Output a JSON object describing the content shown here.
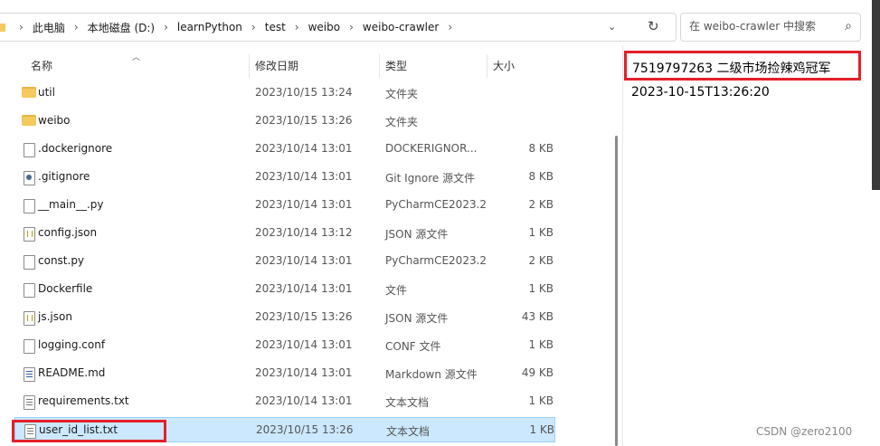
{
  "address_bar": {
    "path": [
      "此电脑",
      "本地磁盘 (D:)",
      "learnPython",
      "test",
      "weibo",
      "weibo-crawler"
    ]
  },
  "search": {
    "placeholder": "在 weibo-crawler 中搜索"
  },
  "columns": {
    "name": "名称",
    "date": "修改日期",
    "type": "类型",
    "size": "大小"
  },
  "files": [
    {
      "name": "util",
      "date": "2023/10/15 13:24",
      "type": "文件夹",
      "size": "",
      "icon": "folder-icon"
    },
    {
      "name": "weibo",
      "date": "2023/10/15 13:26",
      "type": "文件夹",
      "size": "",
      "icon": "folder-icon"
    },
    {
      "name": ".dockerignore",
      "date": "2023/10/14 13:01",
      "type": "DOCKERIGNOR...",
      "size": "8 KB",
      "icon": "file-icon"
    },
    {
      "name": ".gitignore",
      "date": "2023/10/14 13:01",
      "type": "Git Ignore 源文件",
      "size": "8 KB",
      "icon": "gear-file-icon"
    },
    {
      "name": "__main__.py",
      "date": "2023/10/14 13:01",
      "type": "PyCharmCE2023.2",
      "size": "2 KB",
      "icon": "file-icon"
    },
    {
      "name": "config.json",
      "date": "2023/10/14 13:12",
      "type": "JSON 源文件",
      "size": "1 KB",
      "icon": "json-file-icon"
    },
    {
      "name": "const.py",
      "date": "2023/10/14 13:01",
      "type": "PyCharmCE2023.2",
      "size": "2 KB",
      "icon": "file-icon"
    },
    {
      "name": "Dockerfile",
      "date": "2023/10/14 13:01",
      "type": "文件",
      "size": "1 KB",
      "icon": "file-icon"
    },
    {
      "name": "js.json",
      "date": "2023/10/15 13:26",
      "type": "JSON 源文件",
      "size": "43 KB",
      "icon": "json-file-icon"
    },
    {
      "name": "logging.conf",
      "date": "2023/10/14 13:01",
      "type": "CONF 文件",
      "size": "1 KB",
      "icon": "file-icon"
    },
    {
      "name": "README.md",
      "date": "2023/10/14 13:01",
      "type": "Markdown 源文件",
      "size": "49 KB",
      "icon": "md-file-icon"
    },
    {
      "name": "requirements.txt",
      "date": "2023/10/14 13:01",
      "type": "文本文档",
      "size": "1 KB",
      "icon": "txt-file-icon"
    },
    {
      "name": "user_id_list.txt",
      "date": "2023/10/15 13:26",
      "type": "文本文档",
      "size": "1 KB",
      "icon": "txt-file-icon",
      "selected": true
    }
  ],
  "preview": {
    "line1": "7519797263 二级市场捡辣鸡冠军",
    "line2": "2023-10-15T13:26:20"
  },
  "watermark": "CSDN @zero2100",
  "colors": {
    "highlight": "#e3202a",
    "selection": "#cce8ff"
  }
}
